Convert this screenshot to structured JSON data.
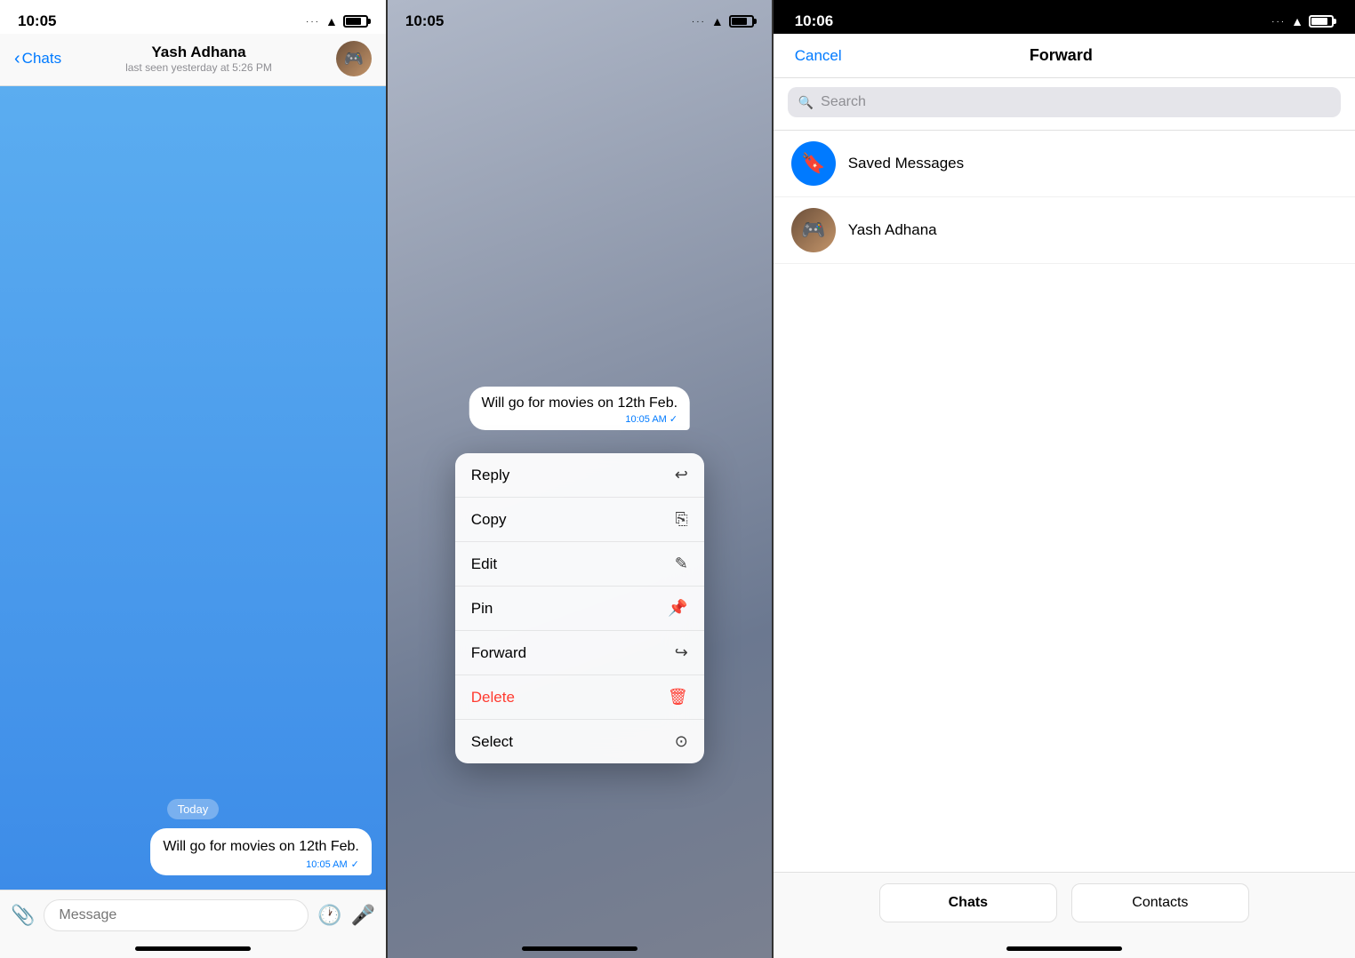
{
  "panel1": {
    "status_time": "10:05",
    "back_label": "Chats",
    "contact_name": "Yash Adhana",
    "contact_status": "last seen yesterday at 5:26 PM",
    "date_badge": "Today",
    "message_text": "Will go for movies on 12th Feb.",
    "message_time": "10:05 AM",
    "message_placeholder": "Message",
    "home_indicator": ""
  },
  "panel2": {
    "status_time": "10:05",
    "message_text": "Will go for movies on 12th Feb.",
    "message_time": "10:05 AM",
    "menu_items": [
      {
        "label": "Reply",
        "icon": "↩",
        "color": "normal"
      },
      {
        "label": "Copy",
        "icon": "⎘",
        "color": "normal"
      },
      {
        "label": "Edit",
        "icon": "✎",
        "color": "normal"
      },
      {
        "label": "Pin",
        "icon": "📌",
        "color": "normal"
      },
      {
        "label": "Forward",
        "icon": "↪",
        "color": "normal"
      },
      {
        "label": "Delete",
        "icon": "🗑",
        "color": "delete"
      },
      {
        "label": "Select",
        "icon": "✓",
        "color": "normal"
      }
    ]
  },
  "panel3": {
    "status_time": "10:06",
    "cancel_label": "Cancel",
    "title": "Forward",
    "search_placeholder": "Search",
    "contacts": [
      {
        "name": "Saved Messages",
        "type": "saved"
      },
      {
        "name": "Yash Adhana",
        "type": "user"
      }
    ],
    "tab_chats": "Chats",
    "tab_contacts": "Contacts"
  }
}
